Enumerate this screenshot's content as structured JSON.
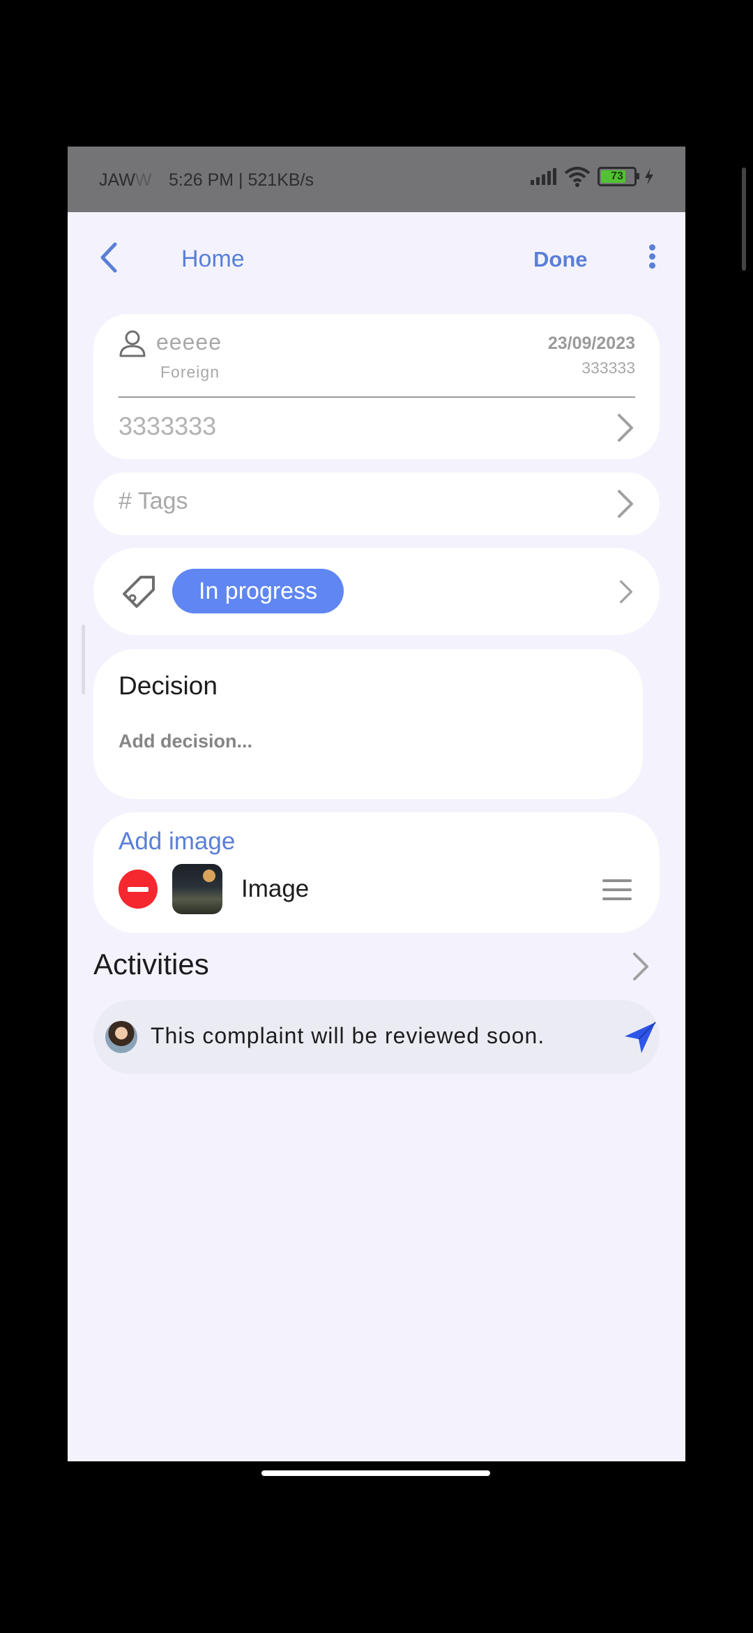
{
  "status_bar": {
    "carrier_main": "JAW",
    "carrier_faded": "W",
    "time_speed": "5:26 PM | 521KB/s",
    "battery": "73"
  },
  "nav": {
    "title": "Home",
    "done_label": "Done"
  },
  "person": {
    "name": "eeeee",
    "nationality": "Foreign",
    "date": "23/09/2023",
    "code": "333333",
    "phone": "3333333"
  },
  "tags": {
    "placeholder": "# Tags"
  },
  "status": {
    "label": "In progress",
    "color": "#5f86f2"
  },
  "decision": {
    "title": "Decision",
    "placeholder": "Add decision..."
  },
  "images": {
    "add_label": "Add image",
    "items": [
      {
        "label": "Image"
      }
    ]
  },
  "activities": {
    "title": "Activities",
    "comment": "This complaint will be reviewed soon."
  },
  "colors": {
    "accent": "#5a7fd6",
    "background": "#f4f3fd",
    "remove": "#f4282e",
    "send": "#2f55e8"
  }
}
